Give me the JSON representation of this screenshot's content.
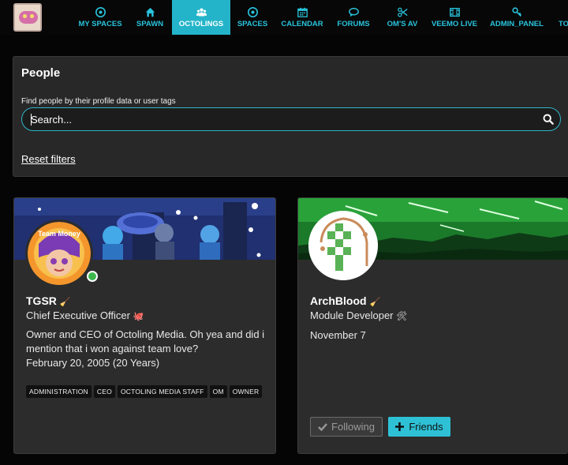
{
  "nav": {
    "items": [
      {
        "label": "MY SPACES",
        "icon": "target-icon"
      },
      {
        "label": "SPAWN",
        "icon": "home-icon"
      },
      {
        "label": "OCTOLINGS",
        "icon": "users-icon"
      },
      {
        "label": "SPACES",
        "icon": "target-icon"
      },
      {
        "label": "CALENDAR",
        "icon": "calendar-icon"
      },
      {
        "label": "FORUMS",
        "icon": "comments-icon"
      },
      {
        "label": "OM'S AV",
        "icon": "scissors-icon"
      },
      {
        "label": "VEEMO LIVE",
        "icon": "film-icon"
      },
      {
        "label": "ADMIN_PANEL",
        "icon": "key-icon"
      },
      {
        "label": "TO",
        "icon": "more-icon"
      }
    ],
    "active": "OCTOLINGS",
    "accent": "#23b4c9"
  },
  "people": {
    "title": "People",
    "find_label": "Find people by their profile data or user tags",
    "search_placeholder": "Search...",
    "reset_label": "Reset filters"
  },
  "cards": [
    {
      "name": "TGSR",
      "name_emoji": "🧹",
      "role": "Chief Executive Officer",
      "role_emoji": "🐙",
      "bio": "Owner and CEO of Octoling Media. Oh yea and did i mention that i won against team love?",
      "date": "February 20, 2005 (20 Years)",
      "tags": [
        "ADMINISTRATION",
        "CEO",
        "OCTOLING MEDIA STAFF",
        "OM",
        "OWNER"
      ],
      "online": true,
      "avatar_text": "Team Money"
    },
    {
      "name": "ArchBlood",
      "name_emoji": "🧹",
      "role": "Module Developer",
      "role_emoji": "🛠",
      "date": "November 7",
      "following_label": "Following",
      "friends_label": "Friends"
    }
  ]
}
